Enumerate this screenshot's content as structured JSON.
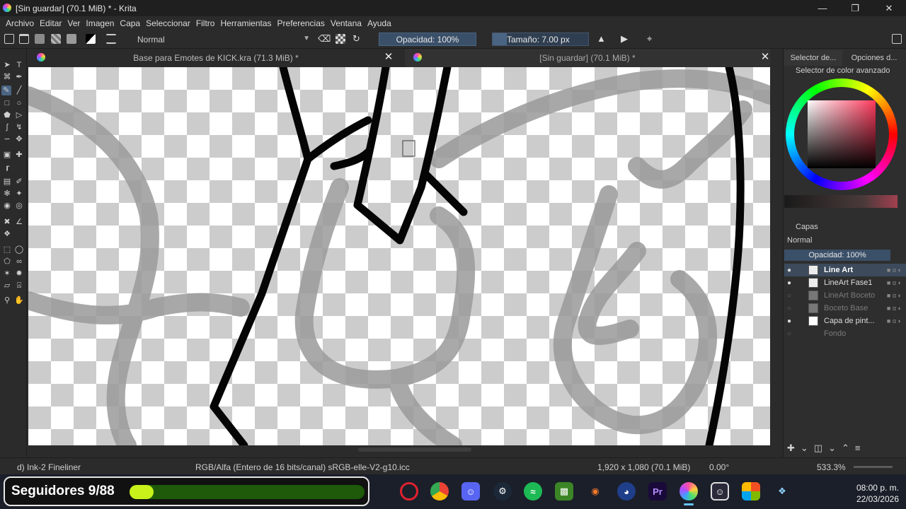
{
  "window": {
    "title": "[Sin guardar]  (70.1 MiB) * - Krita",
    "controls": [
      "minimize",
      "maximize",
      "close"
    ]
  },
  "menu": [
    "Archivo",
    "Editar",
    "Ver",
    "Imagen",
    "Capa",
    "Seleccionar",
    "Filtro",
    "Herramientas",
    "Preferencias",
    "Ventana",
    "Ayuda"
  ],
  "toolbar": {
    "blend_mode": "Normal",
    "opacity": "Opacidad: 100%",
    "size": "Tamaño: 7.00 px"
  },
  "tabs": [
    {
      "label": "Base para Emotes de KICK.kra (71.3 MiB) *",
      "active": false
    },
    {
      "label": "[Sin guardar]  (70.1 MiB) *",
      "active": true
    }
  ],
  "docker": {
    "tabs": [
      "Selector de...",
      "Opciones d..."
    ],
    "color_selector_title": "Selector de color avanzado",
    "layers_title": "Capas",
    "layers_blend": "Normal",
    "layers_opacity": "Opacidad:  100%",
    "layers": [
      {
        "name": "Line Art",
        "visible": true,
        "active": true
      },
      {
        "name": "LineArt Fase1",
        "visible": true,
        "active": false
      },
      {
        "name": "LineArt Boceto",
        "visible": false,
        "active": false
      },
      {
        "name": "Boceto Base",
        "visible": false,
        "active": false
      },
      {
        "name": "Capa de pint...",
        "visible": true,
        "active": false
      },
      {
        "name": "Fondo",
        "visible": false,
        "active": false
      }
    ]
  },
  "status": {
    "brush": "d) Ink-2 Fineliner",
    "color_space": "RGB/Alfa (Entero de 16 bits/canal)  sRGB-elle-V2-g10.icc",
    "dimensions": "1,920 x 1,080 (70.1 MiB)",
    "rotation": "0.00°",
    "zoom": "533.3%"
  },
  "taskbar": {
    "followers_label": "Seguidores 9/88",
    "followers_current": 9,
    "followers_goal": 88,
    "apps": [
      "Opera",
      "Chrome",
      "Discord",
      "Steam",
      "Spotify",
      "Minecraft",
      "Blender",
      "Cinema 4D",
      "Premiere Pro",
      "Krita",
      "Game",
      "Microsoft Store",
      "Snipping"
    ],
    "time": "08:00 p. m.",
    "date": "22/03/2026"
  },
  "colors": {
    "accent": "#4a6583",
    "followers_fill": "#c8f21a",
    "followers_track": "#1e5a0a"
  }
}
